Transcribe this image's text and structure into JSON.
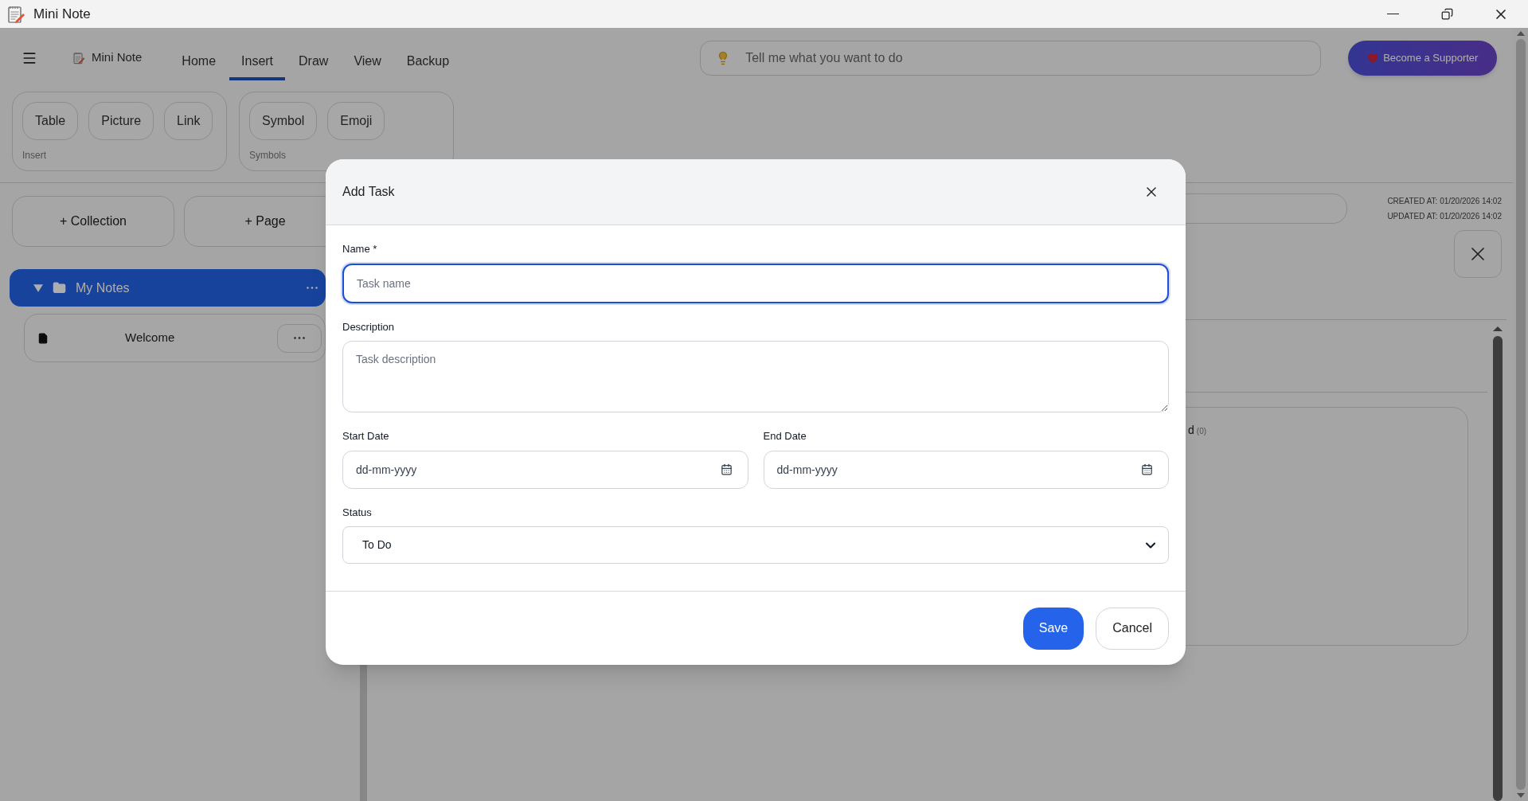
{
  "window": {
    "title": "Mini Note"
  },
  "app_bar": {
    "logo": "Mini Note",
    "tabs": [
      {
        "label": "Home",
        "selected": false
      },
      {
        "label": "Insert",
        "selected": true
      },
      {
        "label": "Draw",
        "selected": false
      },
      {
        "label": "View",
        "selected": false
      },
      {
        "label": "Backup",
        "selected": false
      }
    ],
    "search": {
      "placeholder": "Tell me what you want to do"
    },
    "supporter_button": "Become a Supporter"
  },
  "ribbon": {
    "groups": [
      {
        "label": "Insert",
        "buttons": [
          "Table",
          "Picture",
          "Link"
        ]
      },
      {
        "label": "Symbols",
        "buttons": [
          "Symbol",
          "Emoji"
        ]
      }
    ]
  },
  "sidebar": {
    "buttons": [
      "+ Collection",
      "+ Page"
    ],
    "tree": [
      {
        "label": "My Notes",
        "expanded": true,
        "selected": true,
        "children": [
          {
            "label": "Welcome"
          }
        ]
      }
    ]
  },
  "page": {
    "created": "CREATED AT: 01/20/2026 14:02",
    "updated": "UPDATED AT: 01/20/2026 14:02",
    "panel": {
      "label_tail": "d",
      "count": "(0)"
    }
  },
  "dialog": {
    "title": "Add Task",
    "rows": [
      {
        "fields": [
          {
            "kind": "text",
            "label": "Name *",
            "placeholder": "Task name",
            "focused": true
          }
        ]
      },
      {
        "fields": [
          {
            "kind": "textarea",
            "label": "Description",
            "placeholder": "Task description",
            "focused": false
          }
        ]
      },
      {
        "fields": [
          {
            "kind": "date",
            "label": "Start Date",
            "placeholder": "dd-mm-yyyy",
            "focused": false
          },
          {
            "kind": "date",
            "label": "End Date",
            "placeholder": "dd-mm-yyyy",
            "focused": false
          }
        ]
      },
      {
        "fields": [
          {
            "kind": "select",
            "label": "Status",
            "value": "To Do",
            "focused": false
          }
        ]
      }
    ],
    "buttons": [
      {
        "label": "Save",
        "primary": true
      },
      {
        "label": "Cancel",
        "primary": false
      }
    ]
  }
}
